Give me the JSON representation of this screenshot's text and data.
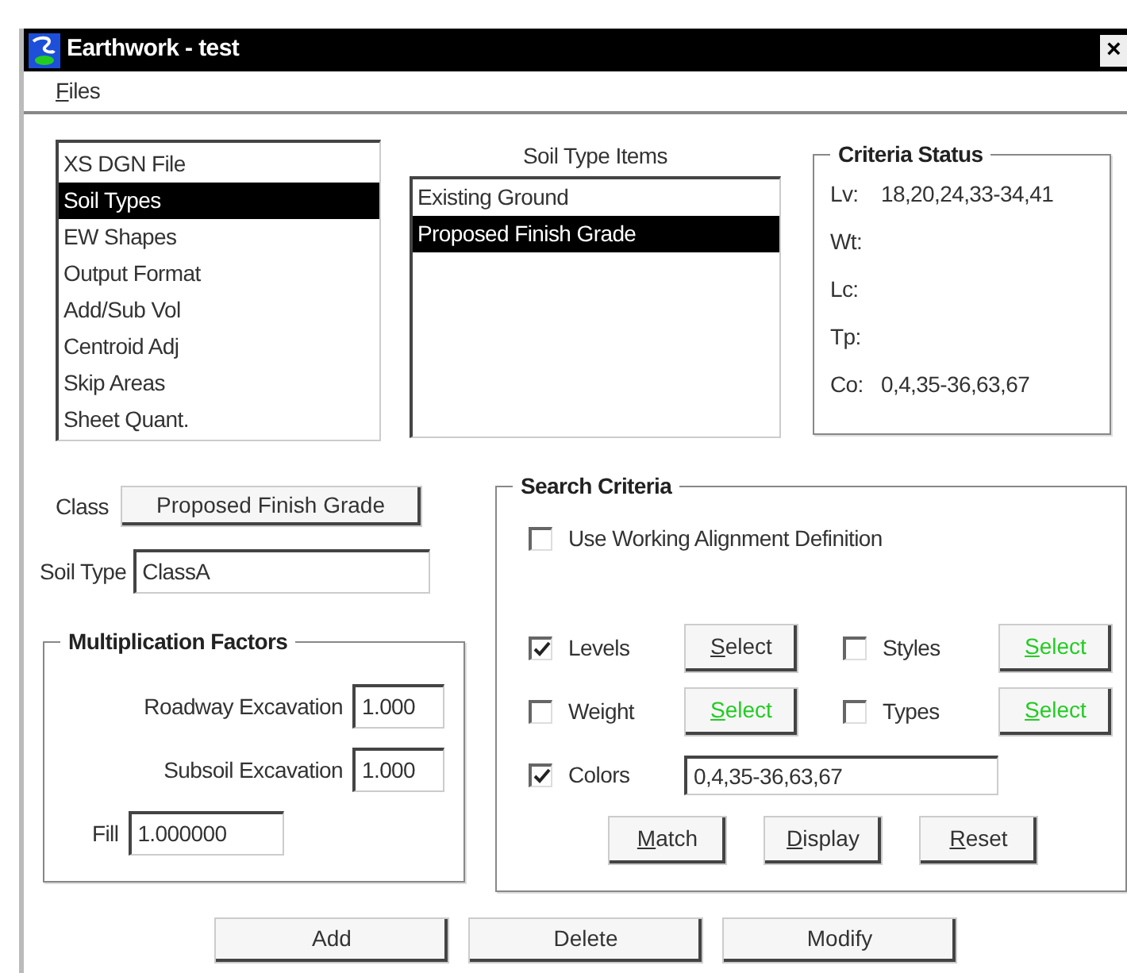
{
  "window": {
    "title": "Earthwork - test",
    "close": "×"
  },
  "menu": [
    {
      "label": "Files",
      "mnemonic": true
    }
  ],
  "sections": {
    "items": [
      {
        "label": "XS DGN File",
        "selected": false
      },
      {
        "label": "Soil Types",
        "selected": true
      },
      {
        "label": "EW Shapes",
        "selected": false
      },
      {
        "label": "Output Format",
        "selected": false
      },
      {
        "label": "Add/Sub Vol",
        "selected": false
      },
      {
        "label": "Centroid Adj",
        "selected": false
      },
      {
        "label": "Skip Areas",
        "selected": false
      },
      {
        "label": "Sheet Quant.",
        "selected": false
      }
    ]
  },
  "soil_type_items": {
    "label": "Soil Type Items",
    "items": [
      {
        "label": "Existing Ground",
        "selected": false
      },
      {
        "label": "Proposed Finish Grade",
        "selected": true
      }
    ]
  },
  "criteria_status": {
    "title": "Criteria  Status",
    "rows": [
      {
        "label": "Lv:",
        "value": "18,20,24,33-34,41"
      },
      {
        "label": "Wt:"
      },
      {
        "label": "Lc:"
      },
      {
        "label": "Tp:"
      },
      {
        "label": "Co:",
        "value": "0,4,35-36,63,67"
      }
    ]
  },
  "class": {
    "label": "Class",
    "button": "Proposed Finish Grade"
  },
  "soil_type": {
    "label": "Soil Type",
    "value": "ClassA"
  },
  "multiplication_factors": {
    "title": "Multiplication Factors",
    "fields": [
      {
        "label": "Roadway Excavation",
        "value": "1.000"
      },
      {
        "label": "Subsoil Excavation",
        "value": "1.000"
      },
      {
        "label": "Fill",
        "value": "1.000000"
      }
    ]
  },
  "search_criteria": {
    "title": "Search Criteria",
    "use_working_alignment": {
      "label": "Use Working Alignment Definition",
      "checked": false
    },
    "criteria": [
      {
        "kind": "button",
        "label": "Levels",
        "checked": true,
        "button": {
          "label": "Select",
          "disabled": false,
          "mnemonic": true
        }
      },
      {
        "kind": "button",
        "label": "Styles",
        "checked": false,
        "button": {
          "label": "Select",
          "disabled": true,
          "mnemonic": true
        }
      },
      {
        "kind": "button",
        "label": "Weight",
        "checked": false,
        "button": {
          "label": "Select",
          "disabled": true,
          "mnemonic": true
        }
      },
      {
        "kind": "button",
        "label": "Types",
        "checked": false,
        "button": {
          "label": "Select",
          "disabled": true,
          "mnemonic": true
        }
      },
      {
        "kind": "field",
        "label": "Colors",
        "checked": true,
        "value": "0,4,35-36,63,67"
      }
    ],
    "actions": [
      {
        "label": "Match",
        "mnemonic": true
      },
      {
        "label": "Display",
        "mnemonic": true
      },
      {
        "label": "Reset",
        "mnemonic": true
      }
    ]
  },
  "buttons": [
    {
      "label": "Add"
    },
    {
      "label": "Delete"
    },
    {
      "label": "Modify"
    }
  ]
}
